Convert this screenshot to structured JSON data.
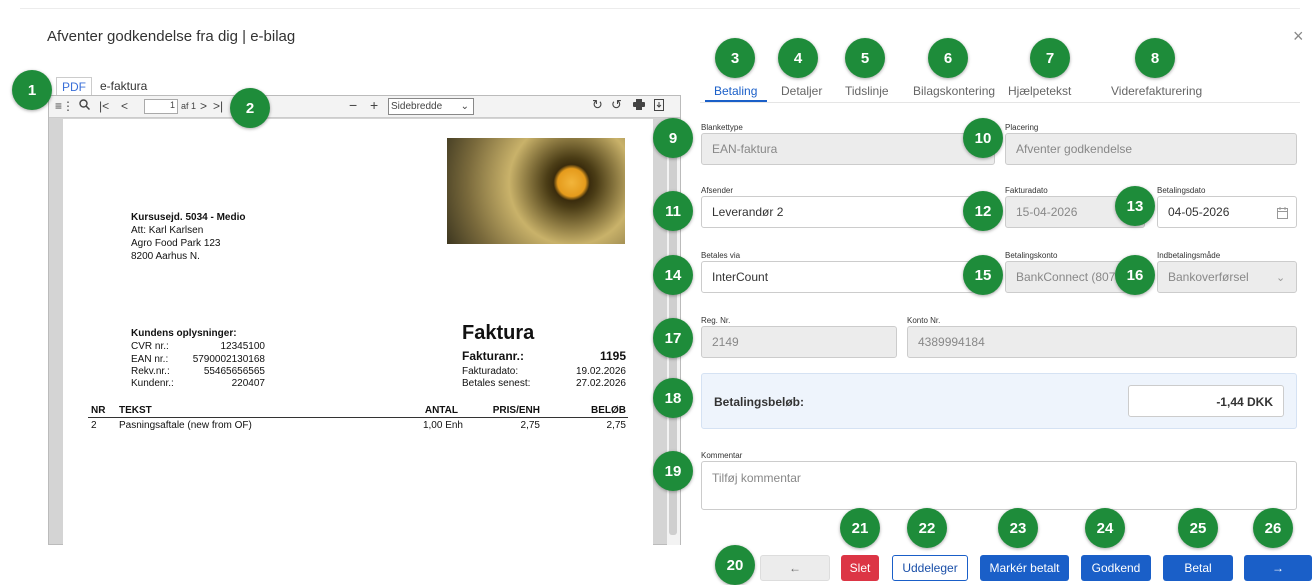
{
  "header": {
    "title": "Afventer godkendelse fra dig | e-bilag",
    "close_symbol": "×"
  },
  "badges": [
    "1",
    "2",
    "3",
    "4",
    "5",
    "6",
    "7",
    "8",
    "9",
    "10",
    "11",
    "12",
    "13",
    "14",
    "15",
    "16",
    "17",
    "18",
    "19",
    "20",
    "21",
    "22",
    "23",
    "24",
    "25",
    "26"
  ],
  "viewer_tabs": {
    "pdf": "PDF",
    "efaktura": "e-faktura"
  },
  "pdf_toolbar": {
    "page_value": "1",
    "page_of": "af 1",
    "zoom_value": "Sidebredde"
  },
  "document": {
    "recipient": {
      "name": "Kursusejd. 5034 - Medio",
      "att": "Att: Karl Karlsen",
      "street": "Agro Food Park 123",
      "city": "8200  Aarhus N."
    },
    "customer": {
      "heading": "Kundens oplysninger:",
      "rows": [
        {
          "k": "CVR nr.:",
          "v": "12345100"
        },
        {
          "k": "EAN nr.:",
          "v": "5790002130168"
        },
        {
          "k": "Rekv.nr.:",
          "v": "55465656565"
        },
        {
          "k": "Kundenr.:",
          "v": "220407"
        }
      ]
    },
    "invoice": {
      "heading": "Faktura",
      "number_label": "Fakturanr.:",
      "number": "1195",
      "date_label": "Fakturadato:",
      "date": "19.02.2026",
      "due_label": "Betales senest:",
      "due": "27.02.2026"
    },
    "columns": {
      "nr": "NR",
      "tekst": "TEKST",
      "antal": "ANTAL",
      "pris": "PRIS/ENH",
      "belob": "BELØB"
    },
    "lines": [
      {
        "nr": "2",
        "tekst": "Pasningsaftale (new from OF)",
        "antal": "1,00 Enh",
        "pris": "2,75",
        "belob": "2,75"
      }
    ]
  },
  "tabs": [
    "Betaling",
    "Detaljer",
    "Tidslinje",
    "Bilagskontering",
    "Hjælpetekst",
    "Viderefakturering"
  ],
  "form": {
    "blankettype": {
      "label": "Blankettype",
      "value": "EAN-faktura"
    },
    "placering": {
      "label": "Placering",
      "value": "Afventer godkendelse"
    },
    "afsender": {
      "label": "Afsender",
      "value": "Leverandør 2"
    },
    "fakturadato": {
      "label": "Fakturadato",
      "value": "15-04-2026"
    },
    "betalingsdato": {
      "label": "Betalingsdato",
      "value": "04-05-2026"
    },
    "betales_via": {
      "label": "Betales via",
      "value": "InterCount"
    },
    "betalingskonto": {
      "label": "Betalingskonto",
      "value": "BankConnect (807"
    },
    "indbetalingsmade": {
      "label": "Indbetalingsmåde",
      "value": "Bankoverførsel"
    },
    "reg_nr": {
      "label": "Reg. Nr.",
      "value": "2149"
    },
    "konto_nr": {
      "label": "Konto Nr.",
      "value": "4389994184"
    },
    "betalingsbelob": {
      "label": "Betalingsbeløb:",
      "value": "-1,44 DKK"
    },
    "kommentar": {
      "label": "Kommentar",
      "placeholder": "Tilføj kommentar"
    }
  },
  "buttons": {
    "back": "←",
    "slet": "Slet",
    "uddeleger": "Uddeleger",
    "marker": "Markér betalt",
    "godkend": "Godkend",
    "betal": "Betal",
    "next": "→"
  }
}
